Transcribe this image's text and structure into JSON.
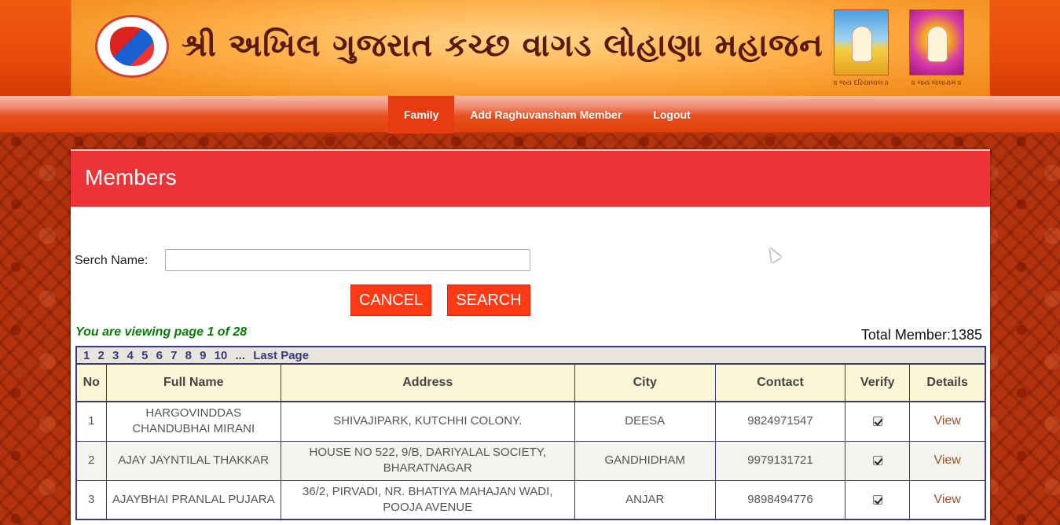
{
  "header": {
    "title": "શ્રી અખિલ ગુજરાત કચ્છ વાગડ લોહાણા મહાજન",
    "deity_captions": [
      "॥ જય દરિયાલાલ ॥",
      "॥ જય જલારામ ॥"
    ]
  },
  "nav": {
    "items": [
      {
        "label": "Family",
        "active": true
      },
      {
        "label": "Add Raghuvansham Member",
        "active": false
      },
      {
        "label": "Logout",
        "active": false
      }
    ]
  },
  "panel": {
    "title": "Members",
    "search_label": "Serch Name:",
    "search_value": "",
    "cancel_label": "CANCEL",
    "search_label_btn": "SEARCH",
    "viewing_text": "You are viewing page 1 of 28",
    "total_text": "Total Member:1385"
  },
  "pager": [
    "1",
    "2",
    "3",
    "4",
    "5",
    "6",
    "7",
    "8",
    "9",
    "10",
    "...",
    "Last Page"
  ],
  "table": {
    "headers": [
      "No",
      "Full Name",
      "Address",
      "City",
      "Contact",
      "Verify",
      "Details"
    ],
    "rows": [
      {
        "no": "1",
        "name": "HARGOVINDDAS CHANDUBHAI MIRANI",
        "address": "SHIVAJIPARK, KUTCHHI COLONY.",
        "city": "DEESA",
        "contact": "9824971547",
        "verified": true,
        "details": "View"
      },
      {
        "no": "2",
        "name": "AJAY JAYNTILAL THAKKAR",
        "address": "HOUSE NO 522, 9/B, DARIYALAL SOCIETY, BHARATNAGAR",
        "city": "GANDHIDHAM",
        "contact": "9979131721",
        "verified": true,
        "details": "View"
      },
      {
        "no": "3",
        "name": "AJAYBHAI PRANLAL PUJARA",
        "address": "36/2, PIRVADI, NR. BHATIYA MAHAJAN WADI, POOJA AVENUE",
        "city": "ANJAR",
        "contact": "9898494776",
        "verified": true,
        "details": "View"
      }
    ]
  },
  "colors": {
    "accent": "#ee3338",
    "button": "#ff3a14",
    "viewing_text": "#0a7a0a",
    "link": "#a0522d"
  }
}
